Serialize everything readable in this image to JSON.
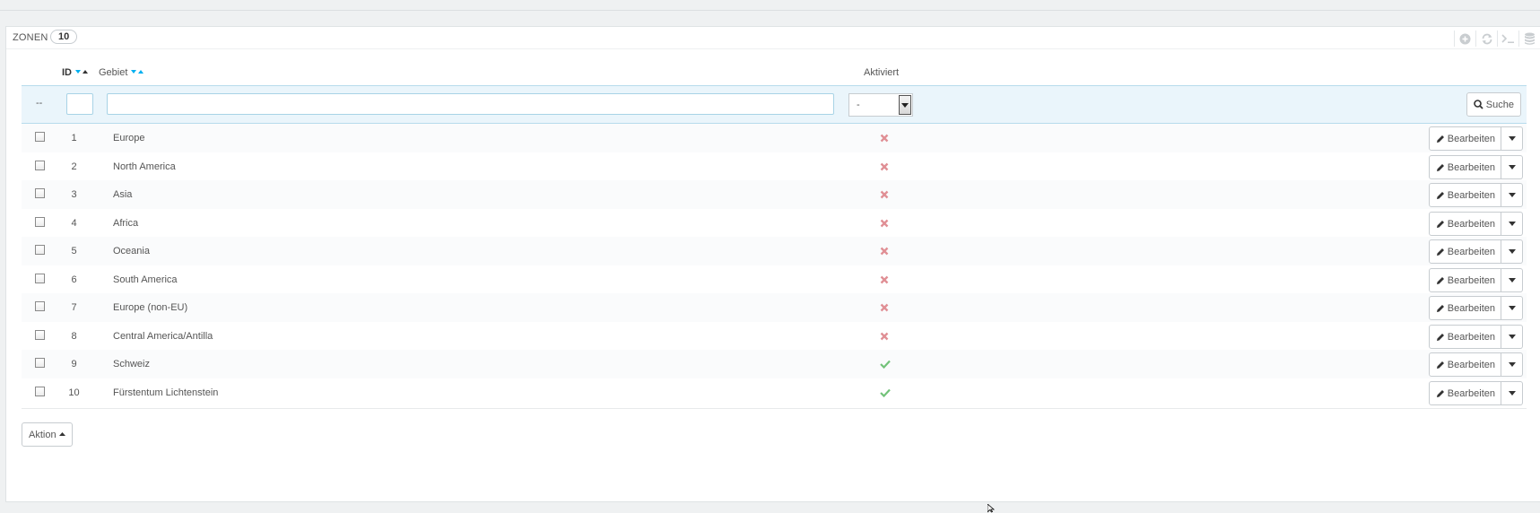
{
  "panel": {
    "title": "Zonen",
    "count": "10"
  },
  "toolbar": {
    "icons": [
      "add-new-icon",
      "refresh-icon",
      "sql-query-icon",
      "export-database-icon"
    ]
  },
  "table": {
    "columns": {
      "id": "ID",
      "name": "Gebiet",
      "active": "Aktiviert"
    },
    "filter": {
      "bulk_placeholder": "--",
      "id_value": "",
      "name_value": "",
      "active_selected": "-",
      "search_label": "Suche"
    },
    "rows": [
      {
        "id": "1",
        "name": "Europe",
        "active": false
      },
      {
        "id": "2",
        "name": "North America",
        "active": false
      },
      {
        "id": "3",
        "name": "Asia",
        "active": false
      },
      {
        "id": "4",
        "name": "Africa",
        "active": false
      },
      {
        "id": "5",
        "name": "Oceania",
        "active": false
      },
      {
        "id": "6",
        "name": "South America",
        "active": false
      },
      {
        "id": "7",
        "name": "Europe (non-EU)",
        "active": false
      },
      {
        "id": "8",
        "name": "Central America/Antilla",
        "active": false
      },
      {
        "id": "9",
        "name": "Schweiz",
        "active": true
      },
      {
        "id": "10",
        "name": "Fürstentum Lichtenstein",
        "active": true
      }
    ],
    "edit_label": "Bearbeiten"
  },
  "bulk": {
    "label": "Aktion"
  },
  "colors": {
    "accent": "#00aff0",
    "disabled_red": "#e08f95",
    "enabled_green": "#72c279",
    "filter_bg": "#eaf5fb"
  }
}
